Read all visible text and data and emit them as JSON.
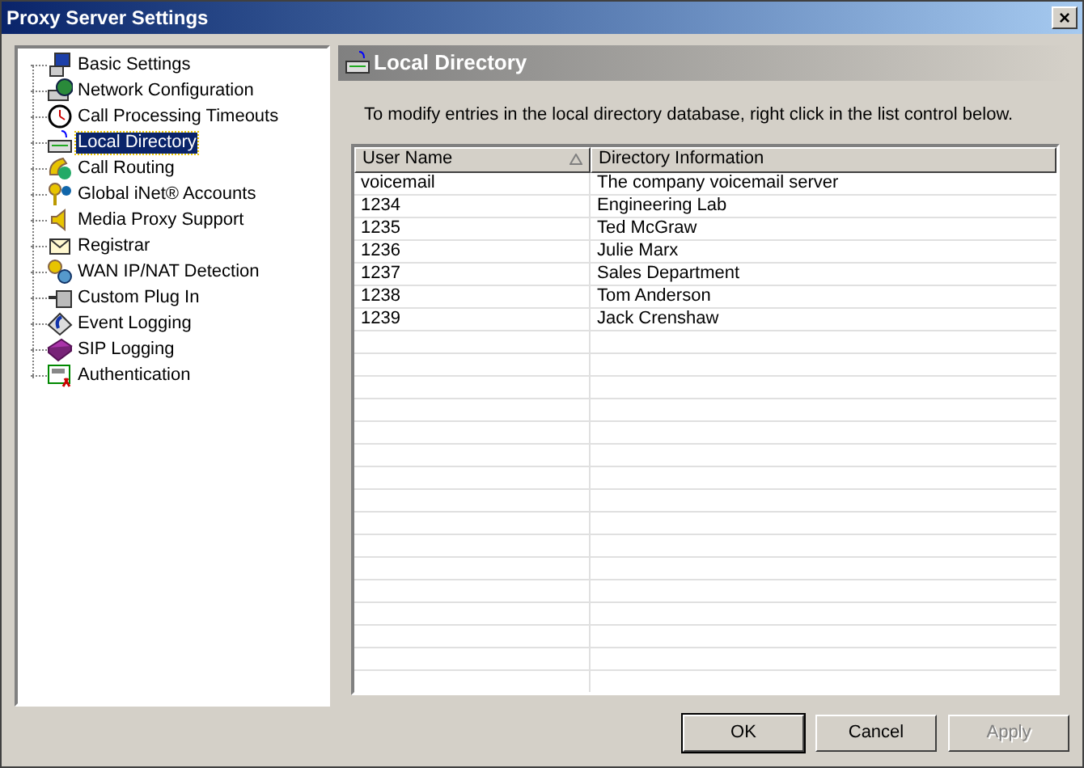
{
  "window": {
    "title": "Proxy Server Settings",
    "close": "×"
  },
  "tree": [
    {
      "label": "Basic Settings",
      "selected": false
    },
    {
      "label": "Network Configuration",
      "selected": false
    },
    {
      "label": "Call Processing Timeouts",
      "selected": false
    },
    {
      "label": "Local Directory",
      "selected": true
    },
    {
      "label": "Call Routing",
      "selected": false
    },
    {
      "label": "Global iNet® Accounts",
      "selected": false
    },
    {
      "label": "Media Proxy Support",
      "selected": false
    },
    {
      "label": "Registrar",
      "selected": false
    },
    {
      "label": "WAN IP/NAT Detection",
      "selected": false
    },
    {
      "label": "Custom Plug In",
      "selected": false
    },
    {
      "label": "Event Logging",
      "selected": false
    },
    {
      "label": "SIP Logging",
      "selected": false
    },
    {
      "label": "Authentication",
      "selected": false
    }
  ],
  "panel": {
    "title": "Local Directory",
    "instructions": "To modify entries in the local directory database, right click in the list control below."
  },
  "table": {
    "columns": [
      {
        "label": "User Name",
        "sorted": true
      },
      {
        "label": "Directory Information",
        "sorted": false
      }
    ],
    "rows": [
      [
        "voicemail",
        "The company voicemail server"
      ],
      [
        "1234",
        "Engineering Lab"
      ],
      [
        "1235",
        "Ted McGraw"
      ],
      [
        "1236",
        "Julie Marx"
      ],
      [
        "1237",
        "Sales Department"
      ],
      [
        "1238",
        "Tom Anderson"
      ],
      [
        "1239",
        "Jack Crenshaw"
      ]
    ]
  },
  "buttons": [
    {
      "label": "OK",
      "disabled": false,
      "default": true
    },
    {
      "label": "Cancel",
      "disabled": false,
      "default": false
    },
    {
      "label": "Apply",
      "disabled": true,
      "default": false
    }
  ]
}
